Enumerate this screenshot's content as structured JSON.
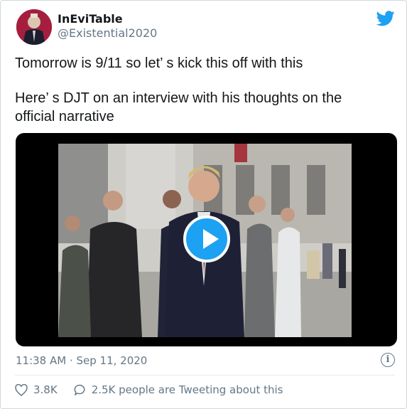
{
  "tweet": {
    "display_name": "InEviTable",
    "handle": "@Existential2020",
    "line1": "Tomorrow is 9/11 so let’ s kick this off with this",
    "line2": "Here’ s DJT on an interview with his thoughts on the",
    "line3": "official narrative",
    "timestamp": "11:38 AM · Sep 11, 2020",
    "likes": "3.8K",
    "replies": "2.5K people are Tweeting about this",
    "info_glyph": "i"
  },
  "icons": {
    "brand": "twitter-bird-icon",
    "play": "play-icon",
    "info": "info-icon",
    "like": "heart-icon",
    "reply": "speech-bubble-icon"
  },
  "colors": {
    "accent": "#1da1f2",
    "muted": "#657786",
    "text": "#14171a"
  }
}
